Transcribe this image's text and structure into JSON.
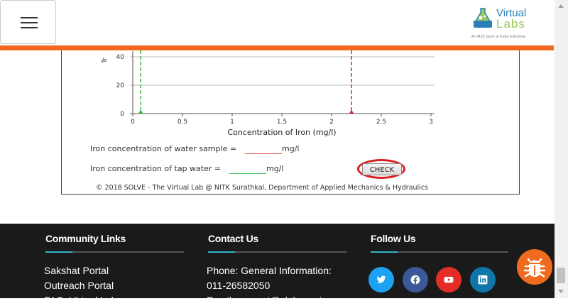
{
  "brand": {
    "line1": "Virtual",
    "line2": "Labs",
    "tagline": "An MoE Govt of India Initiative",
    "colors": {
      "primary": "#2a7fb8",
      "secondary": "#9bc85a",
      "header_bar": "#f26a21"
    }
  },
  "chart_data": {
    "type": "line",
    "xlabel": "Concentration of Iron (mg/l)",
    "ylabel": "Tr",
    "x_ticks": [
      "0",
      "0.5",
      "1",
      "1.5",
      "2",
      "2.5",
      "3"
    ],
    "y_ticks": [
      "0",
      "20",
      "40"
    ],
    "xlim": [
      0,
      3
    ],
    "ylim": [
      0,
      40
    ],
    "grid": "horizontal",
    "series": [
      {
        "color": "#3cb43c",
        "style": "dashed-vertical",
        "x": 0.08
      },
      {
        "color": "#d9262a",
        "style": "dashed-vertical",
        "x": 2.2
      }
    ]
  },
  "sim": {
    "water_sample_label": "Iron concentration of water sample =",
    "water_sample_unit": "mg/l",
    "tap_water_label": "Iron concentration of tap water =",
    "tap_water_unit": "mg/l",
    "check_label": "CHECK",
    "copyright": "© 2018 SOLVE - The Virtual Lab @ NITK Surathkal, Department of Applied Mechanics & Hydraulics"
  },
  "footer": {
    "community": {
      "title": "Community Links",
      "links": [
        "Sakshat Portal",
        "Outreach Portal",
        "FAQ: Virtual Labs"
      ]
    },
    "contact": {
      "title": "Contact Us",
      "lines": [
        "Phone: General Information:",
        "011-26582050",
        "Email: support@vlabs.ac.in"
      ]
    },
    "follow": {
      "title": "Follow Us",
      "icons": [
        "twitter-icon",
        "facebook-icon",
        "youtube-icon",
        "linkedin-icon"
      ]
    },
    "accent_color": "#33b5c9"
  }
}
